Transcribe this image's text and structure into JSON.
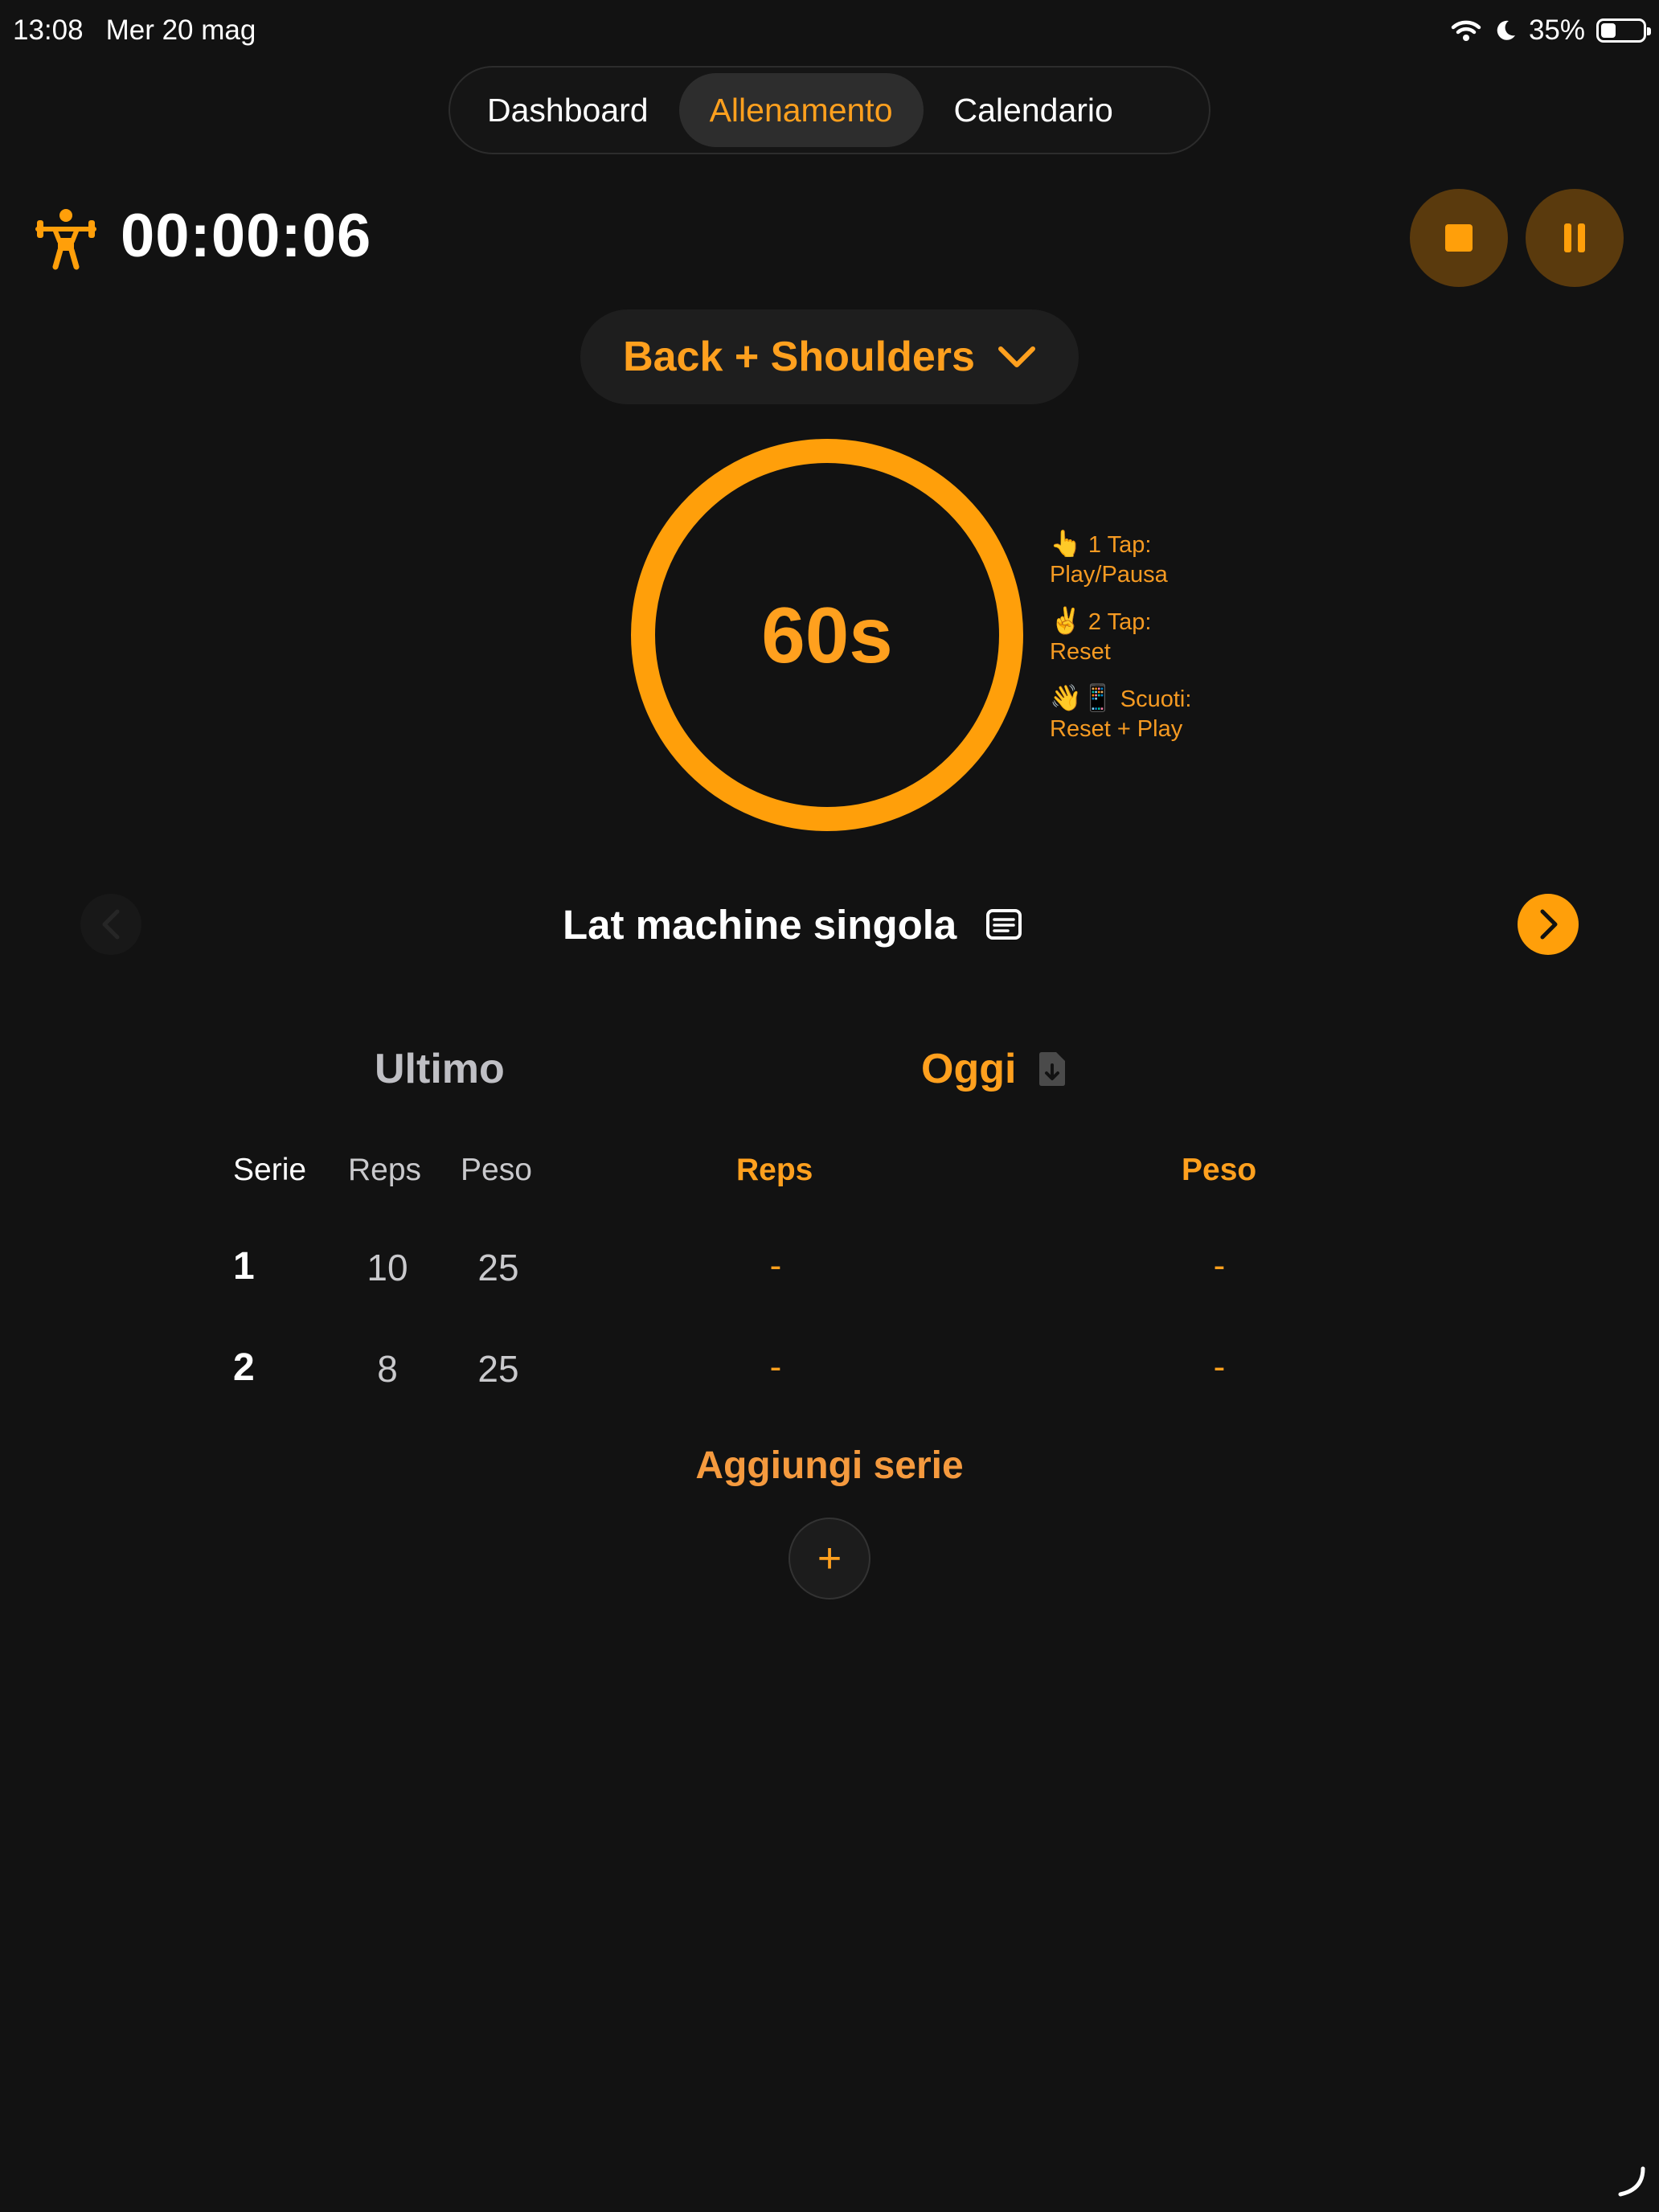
{
  "status_bar": {
    "time": "13:08",
    "date": "Mer 20 mag",
    "battery": "35%",
    "battery_level": 0.35
  },
  "tabs": [
    {
      "label": "Dashboard",
      "active": false
    },
    {
      "label": "Allenamento",
      "active": true
    },
    {
      "label": "Calendario",
      "active": false
    }
  ],
  "session": {
    "elapsed": "00:00:06"
  },
  "workout": {
    "name": "Back + Shoulders"
  },
  "rest_timer": {
    "display": "60s",
    "hints": [
      {
        "emoji": "👆",
        "title": "1 Tap:",
        "action": "Play/Pausa"
      },
      {
        "emoji": "✌️",
        "title": "2 Tap:",
        "action": "Reset"
      },
      {
        "emoji": "👋📱",
        "title": "Scuoti:",
        "action": "Reset + Play"
      }
    ]
  },
  "exercise": {
    "name": "Lat machine singola"
  },
  "last": {
    "title": "Ultimo",
    "headers": {
      "set": "Serie",
      "reps": "Reps",
      "weight": "Peso"
    },
    "rows": [
      {
        "set": "1",
        "reps": "10",
        "weight": "25"
      },
      {
        "set": "2",
        "reps": "8",
        "weight": "25"
      }
    ]
  },
  "today": {
    "title": "Oggi",
    "headers": {
      "reps": "Reps",
      "weight": "Peso"
    },
    "rows": [
      {
        "reps": "-",
        "weight": "-"
      },
      {
        "reps": "-",
        "weight": "-"
      }
    ]
  },
  "add_set": {
    "label": "Aggiungi serie",
    "button": "+"
  },
  "colors": {
    "accent": "#ffa01e",
    "background": "#121212",
    "button_dark": "#5a3a0d"
  }
}
